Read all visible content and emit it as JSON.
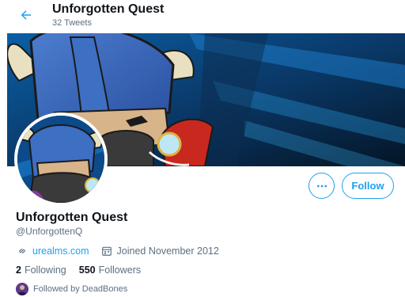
{
  "header": {
    "title": "Unforgotten Quest",
    "tweet_count": "32 Tweets",
    "back_icon": "arrow-left-icon"
  },
  "profile": {
    "name": "Unforgotten Quest",
    "handle": "@UnforgottenQ",
    "website": "urealms.com",
    "joined": "Joined November 2012",
    "following_count": "2",
    "following_label": "Following",
    "followers_count": "550",
    "followers_label": "Followers",
    "followed_by": "Followed by DeadBones"
  },
  "actions": {
    "more_icon": "more-horizontal-icon",
    "follow_label": "Follow"
  },
  "colors": {
    "accent": "#1da1f2",
    "secondary_text": "#5b7083",
    "primary_text": "#0f1419"
  }
}
